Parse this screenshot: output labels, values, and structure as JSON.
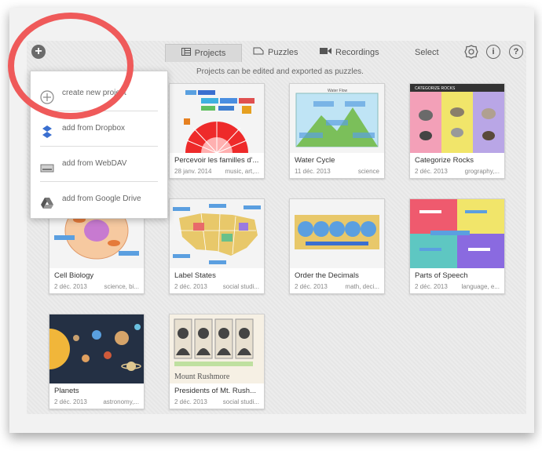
{
  "toolbar": {
    "tabs": [
      {
        "label": "Projects",
        "icon": "projects-icon"
      },
      {
        "label": "Puzzles",
        "icon": "puzzles-icon"
      },
      {
        "label": "Recordings",
        "icon": "camera-icon"
      }
    ],
    "select_label": "Select",
    "info_glyph": "i",
    "help_glyph": "?"
  },
  "hint": "Projects can be edited and exported as puzzles.",
  "menu": {
    "items": [
      {
        "label": "create new project",
        "icon": "plus-circle-icon"
      },
      {
        "label": "add from Dropbox",
        "icon": "dropbox-icon"
      },
      {
        "label": "add from WebDAV",
        "icon": "drive-icon"
      },
      {
        "label": "add from Google Drive",
        "icon": "google-drive-icon"
      }
    ]
  },
  "cards": [
    {
      "title": "Percevoir les familles d'...",
      "date": "28 janv. 2014",
      "tags": "music, art,..."
    },
    {
      "title": "Water Cycle",
      "date": "11 déc. 2013",
      "tags": "science",
      "thumb_caption": "Water Flow"
    },
    {
      "title": "Categorize Rocks",
      "date": "2 déc. 2013",
      "tags": "grography,...",
      "thumb_caption": "CATEGORIZE ROCKS"
    },
    {
      "title": "Cell Biology",
      "date": "2 déc. 2013",
      "tags": "science, bi..."
    },
    {
      "title": "Label States",
      "date": "2 déc. 2013",
      "tags": "social studi..."
    },
    {
      "title": "Order the Decimals",
      "date": "2 déc. 2013",
      "tags": "math, deci..."
    },
    {
      "title": "Parts of Speech",
      "date": "2 déc. 2013",
      "tags": "language, e..."
    },
    {
      "title": "Planets",
      "date": "2 déc. 2013",
      "tags": "astronomy,..."
    },
    {
      "title": "Presidents of Mt. Rush...",
      "date": "2 déc. 2013",
      "tags": "social studi...",
      "thumb_caption": "Mount Rushmore"
    }
  ],
  "colors": {
    "annotation_ring": "#ef5a5a",
    "accent": "#2a7fd4"
  }
}
